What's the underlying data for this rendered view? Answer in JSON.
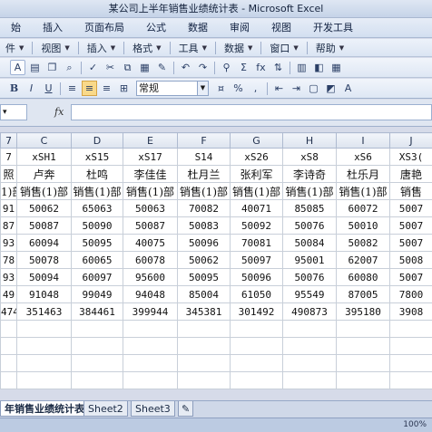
{
  "window": {
    "title": "某公司上半年销售业绩统计表 - Microsoft Excel"
  },
  "menu": [
    "始",
    "插入",
    "页面布局",
    "公式",
    "数据",
    "审阅",
    "视图",
    "开发工具"
  ],
  "toolbar_groups": [
    "件",
    "视图",
    "插入",
    "格式",
    "工具",
    "数据",
    "窗口",
    "帮助"
  ],
  "toolbar2_icons": [
    "a-format-icon",
    "paste-icon",
    "copy-icon",
    "preview-icon",
    "spell-check-icon",
    "cut-icon",
    "copy2-icon",
    "paste2-icon",
    "format-painter-icon",
    "undo-icon",
    "redo-icon",
    "hyperlink-icon",
    "autosum-icon",
    "function-icon",
    "sort-icon",
    "chart-icon",
    "drawing-icon",
    "table-icon"
  ],
  "toolbar2_symbols": {
    "sigma": "Σ",
    "fx": "fx"
  },
  "format_bar": {
    "bold": "B",
    "italic": "I",
    "underline": "U",
    "number_format": "常规"
  },
  "formula_bar": {
    "name_box": "",
    "fx_label": "fx",
    "value": ""
  },
  "grid": {
    "columns": [
      "7",
      "C",
      "D",
      "E",
      "F",
      "G",
      "H",
      "I",
      "J"
    ],
    "ids": [
      "7",
      "xSH1",
      "xS15",
      "xS17",
      "S14",
      "xS26",
      "xS8",
      "xS6",
      "XS3("
    ],
    "names": [
      "照",
      "卢奔",
      "杜鸣",
      "李佳佳",
      "杜月兰",
      "张利军",
      "李诗奇",
      "杜乐月",
      "唐艳"
    ],
    "depts": [
      "1)部",
      "销售(1)部",
      "销售(1)部",
      "销售(1)部",
      "销售(1)部",
      "销售(1)部",
      "销售(1)部",
      "销售(1)部",
      "销售"
    ],
    "rows": [
      [
        "91",
        "50062",
        "65063",
        "50063",
        "70082",
        "40071",
        "85085",
        "60072",
        "5007"
      ],
      [
        "87",
        "50087",
        "50090",
        "50087",
        "50083",
        "50092",
        "50076",
        "50010",
        "5007"
      ],
      [
        "93",
        "60094",
        "50095",
        "40075",
        "50096",
        "70081",
        "50084",
        "50082",
        "5007"
      ],
      [
        "78",
        "50078",
        "60065",
        "60078",
        "50062",
        "50097",
        "95001",
        "62007",
        "5008"
      ],
      [
        "93",
        "50094",
        "60097",
        "95600",
        "50095",
        "50096",
        "50076",
        "60080",
        "5007"
      ],
      [
        "49",
        "91048",
        "99049",
        "94048",
        "85004",
        "61050",
        "95549",
        "87005",
        "7800"
      ],
      [
        "474",
        "351463",
        "384461",
        "399944",
        "345381",
        "301492",
        "490873",
        "395180",
        "3908"
      ]
    ],
    "empty_rows": 4
  },
  "sheets": [
    "年销售业绩统计表",
    "Sheet2",
    "Sheet3"
  ],
  "status": {
    "count": "100%"
  },
  "colors": {
    "accent": "#f9d98a",
    "header_bg": "#dde4ef",
    "chrome": "#d6dbe9"
  }
}
